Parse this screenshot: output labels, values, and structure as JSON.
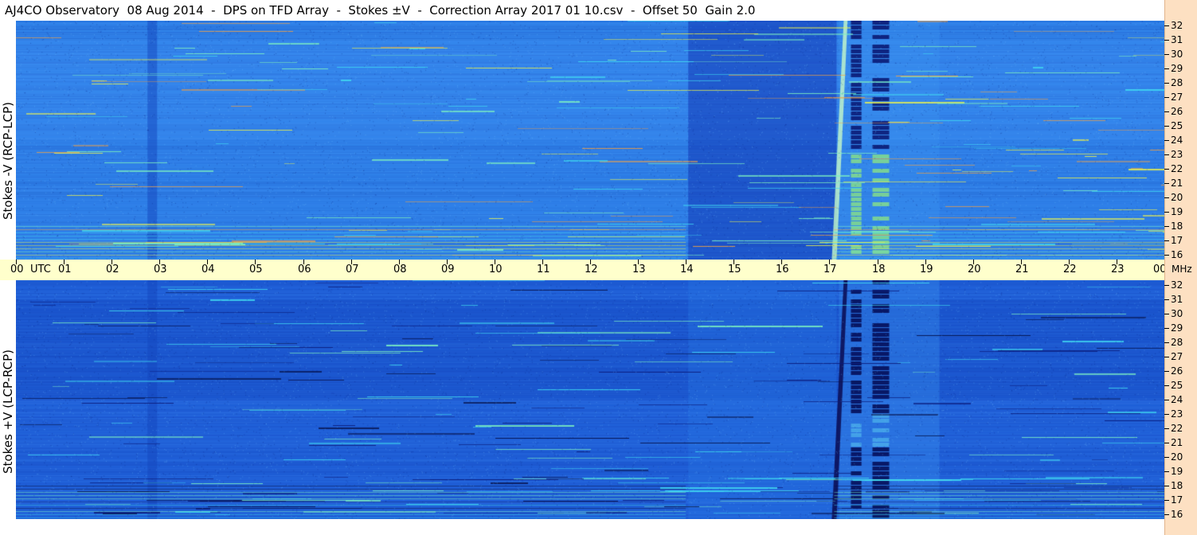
{
  "title": "AJ4CO Observatory  08 Aug 2014  -  DPS on TFD Array  -  Stokes ±V  -  Correction Array 2017 01 10.csv  -  Offset 50  Gain 2.0",
  "chart_data": [
    {
      "type": "heatmap",
      "ylabel": "Stokes -V (RCP-LCP)",
      "xlabel": "UTC",
      "x_ticks": [
        "00",
        "01",
        "02",
        "03",
        "04",
        "05",
        "06",
        "07",
        "08",
        "09",
        "10",
        "11",
        "12",
        "13",
        "14",
        "15",
        "16",
        "17",
        "18",
        "19",
        "20",
        "21",
        "22",
        "23",
        "00"
      ],
      "y_ticks": [
        16,
        17,
        18,
        19,
        20,
        21,
        22,
        23,
        24,
        25,
        26,
        27,
        28,
        29,
        30,
        31,
        32
      ],
      "y_unit": "MHz",
      "xlim": [
        0,
        24
      ],
      "ylim": [
        16,
        32
      ],
      "colormap": [
        "#0a1a8a",
        "#1a4fd6",
        "#2f86ea",
        "#3fb6f2",
        "#5ce8e0",
        "#c8f060",
        "#f4c040",
        "#e04020"
      ],
      "dominant_color": "#2e7fe8"
    },
    {
      "type": "heatmap",
      "ylabel": "Stokes +V (LCP-RCP)",
      "xlabel": "UTC",
      "x_ticks": [
        "00",
        "01",
        "02",
        "03",
        "04",
        "05",
        "06",
        "07",
        "08",
        "09",
        "10",
        "11",
        "12",
        "13",
        "14",
        "15",
        "16",
        "17",
        "18",
        "19",
        "20",
        "21",
        "22",
        "23",
        "00"
      ],
      "y_ticks": [
        16,
        17,
        18,
        19,
        20,
        21,
        22,
        23,
        24,
        25,
        26,
        27,
        28,
        29,
        30,
        31,
        32
      ],
      "y_unit": "MHz",
      "xlim": [
        0,
        24
      ],
      "ylim": [
        16,
        32
      ],
      "colormap": [
        "#0a1a8a",
        "#1a4fd6",
        "#2f86ea",
        "#3fb6f2",
        "#5ce8e0",
        "#c8f060",
        "#f4c040",
        "#e04020"
      ],
      "dominant_color": "#1f5fd8"
    }
  ],
  "axis": {
    "utc_label": "UTC",
    "mhz_label": "MHz"
  }
}
